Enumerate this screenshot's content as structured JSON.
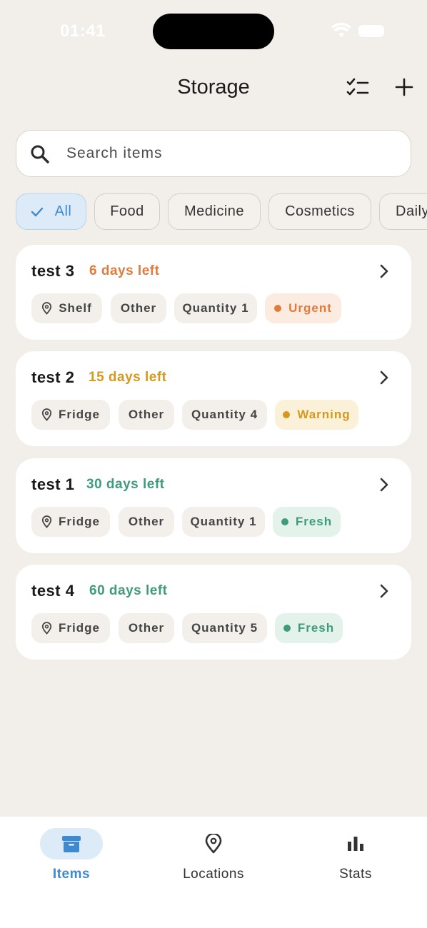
{
  "status_bar": {
    "time": "01:41"
  },
  "header": {
    "title": "Storage"
  },
  "search": {
    "placeholder": "Search items",
    "value": ""
  },
  "filters": [
    {
      "label": "All",
      "selected": true
    },
    {
      "label": "Food",
      "selected": false
    },
    {
      "label": "Medicine",
      "selected": false
    },
    {
      "label": "Cosmetics",
      "selected": false
    },
    {
      "label": "Daily",
      "selected": false
    }
  ],
  "items": [
    {
      "name": "test 3",
      "days_left": "6 days left",
      "days_color": "#e07b3c",
      "location": "Shelf",
      "category": "Other",
      "quantity": "Quantity 1",
      "status": "Urgent",
      "status_color": "#e07b3c",
      "status_bg": "#fcebe0"
    },
    {
      "name": "test 2",
      "days_left": "15 days left",
      "days_color": "#d49a1d",
      "location": "Fridge",
      "category": "Other",
      "quantity": "Quantity 4",
      "status": "Warning",
      "status_color": "#d49a1d",
      "status_bg": "#fbf0d8"
    },
    {
      "name": "test 1",
      "days_left": "30 days left",
      "days_color": "#3f9c7a",
      "location": "Fridge",
      "category": "Other",
      "quantity": "Quantity 1",
      "status": "Fresh",
      "status_color": "#3f9c7a",
      "status_bg": "#e4f2ec"
    },
    {
      "name": "test 4",
      "days_left": "60 days left",
      "days_color": "#3f9c7a",
      "location": "Fridge",
      "category": "Other",
      "quantity": "Quantity 5",
      "status": "Fresh",
      "status_color": "#3f9c7a",
      "status_bg": "#e4f2ec"
    }
  ],
  "tabs": [
    {
      "label": "Items",
      "icon": "archive-box-icon",
      "active": true
    },
    {
      "label": "Locations",
      "icon": "map-pin-icon",
      "active": false
    },
    {
      "label": "Stats",
      "icon": "bar-chart-icon",
      "active": false
    }
  ],
  "colors": {
    "accent": "#3d8ad0",
    "background": "#f2efea"
  }
}
